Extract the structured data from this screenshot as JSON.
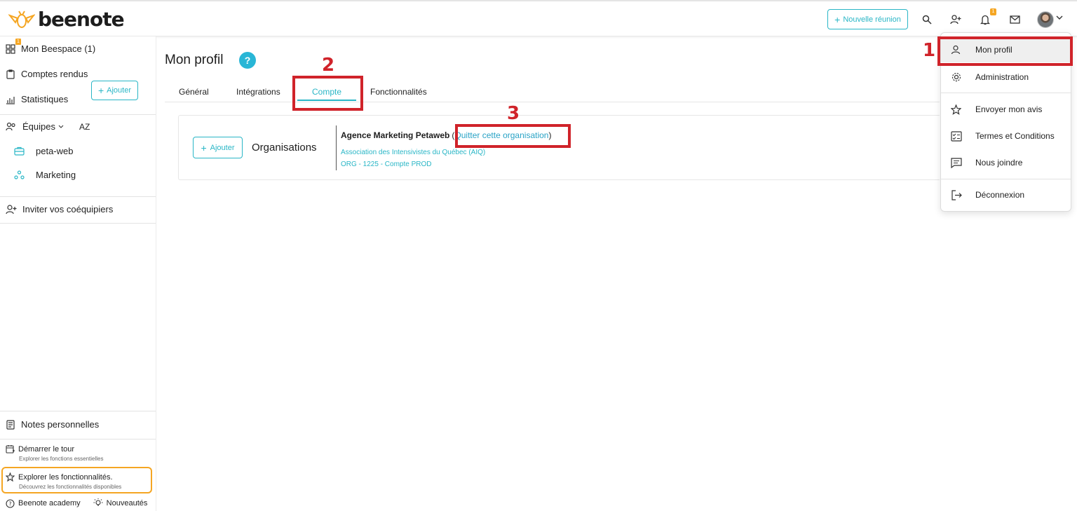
{
  "header": {
    "logo_text": "beenote",
    "new_meeting_label": "Nouvelle réunion",
    "notification_count": "1"
  },
  "sidebar": {
    "beespace_label": "Mon Beespace (1)",
    "beespace_badge": "1",
    "reports_label": "Comptes rendus",
    "stats_label": "Statistiques",
    "teams_label": "Équipes",
    "sort_label": "AZ",
    "add_team_label": "Ajouter",
    "teams": [
      {
        "label": "peta-web"
      },
      {
        "label": "Marketing"
      }
    ],
    "invite_label": "Inviter vos coéquipiers",
    "personal_notes_label": "Notes personnelles",
    "tour_title": "Démarrer le tour",
    "tour_subtitle": "Explorer les fonctions essentielles",
    "explore_title": "Explorer les fonctionnalités.",
    "explore_subtitle": "Découvrez les fonctionnalités disponibles",
    "academy_label": "Beenote academy",
    "news_label": "Nouveautés"
  },
  "main": {
    "title": "Mon profil",
    "help_label": "?",
    "tabs": [
      {
        "label": "Général"
      },
      {
        "label": "Intégrations"
      },
      {
        "label": "Compte"
      },
      {
        "label": "Fonctionnalités"
      }
    ],
    "org_section": {
      "add_label": "Ajouter",
      "label": "Organisations",
      "org_name": "Agence Marketing Petaweb",
      "quit_open": "(",
      "quit_label": "Quitter cette organisation",
      "quit_close": ")",
      "sub_lines": [
        "Association des Intensivistes du Québec (AIQ)",
        "ORG - 1225 - Compte PROD"
      ]
    }
  },
  "dropdown": {
    "items": [
      {
        "label": "Mon profil"
      },
      {
        "label": "Administration"
      },
      {
        "label": "Envoyer mon avis"
      },
      {
        "label": "Termes et Conditions"
      },
      {
        "label": "Nous joindre"
      },
      {
        "label": "Déconnexion"
      }
    ]
  },
  "annotations": {
    "step1": "1",
    "step2": "2",
    "step3": "3"
  },
  "colors": {
    "accent": "#29b6c6",
    "annotation": "#d0232a",
    "badge": "#f5a623"
  }
}
